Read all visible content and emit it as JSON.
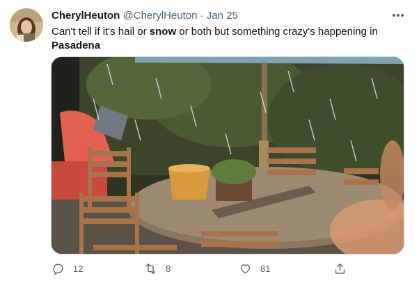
{
  "tweet": {
    "author_name": "CherylHeuton",
    "author_handle": "@CherylHeuton",
    "separator": "·",
    "date": "Jan 25",
    "text_parts": {
      "part1": "Can't tell if it's hail or ",
      "bold1": "snow",
      "part2": " or both but something crazy's happening in ",
      "bold2": "Pasadena"
    }
  },
  "icons": {
    "more": "more-dots-icon",
    "reply": "reply-icon",
    "retweet": "retweet-icon",
    "like": "like-icon",
    "share": "share-icon"
  },
  "actions": {
    "reply_count": "12",
    "retweet_count": "8",
    "like_count": "81"
  },
  "colors": {
    "text_primary": "#0f1419",
    "text_secondary": "#536471",
    "media_border": "#cfd9de"
  }
}
